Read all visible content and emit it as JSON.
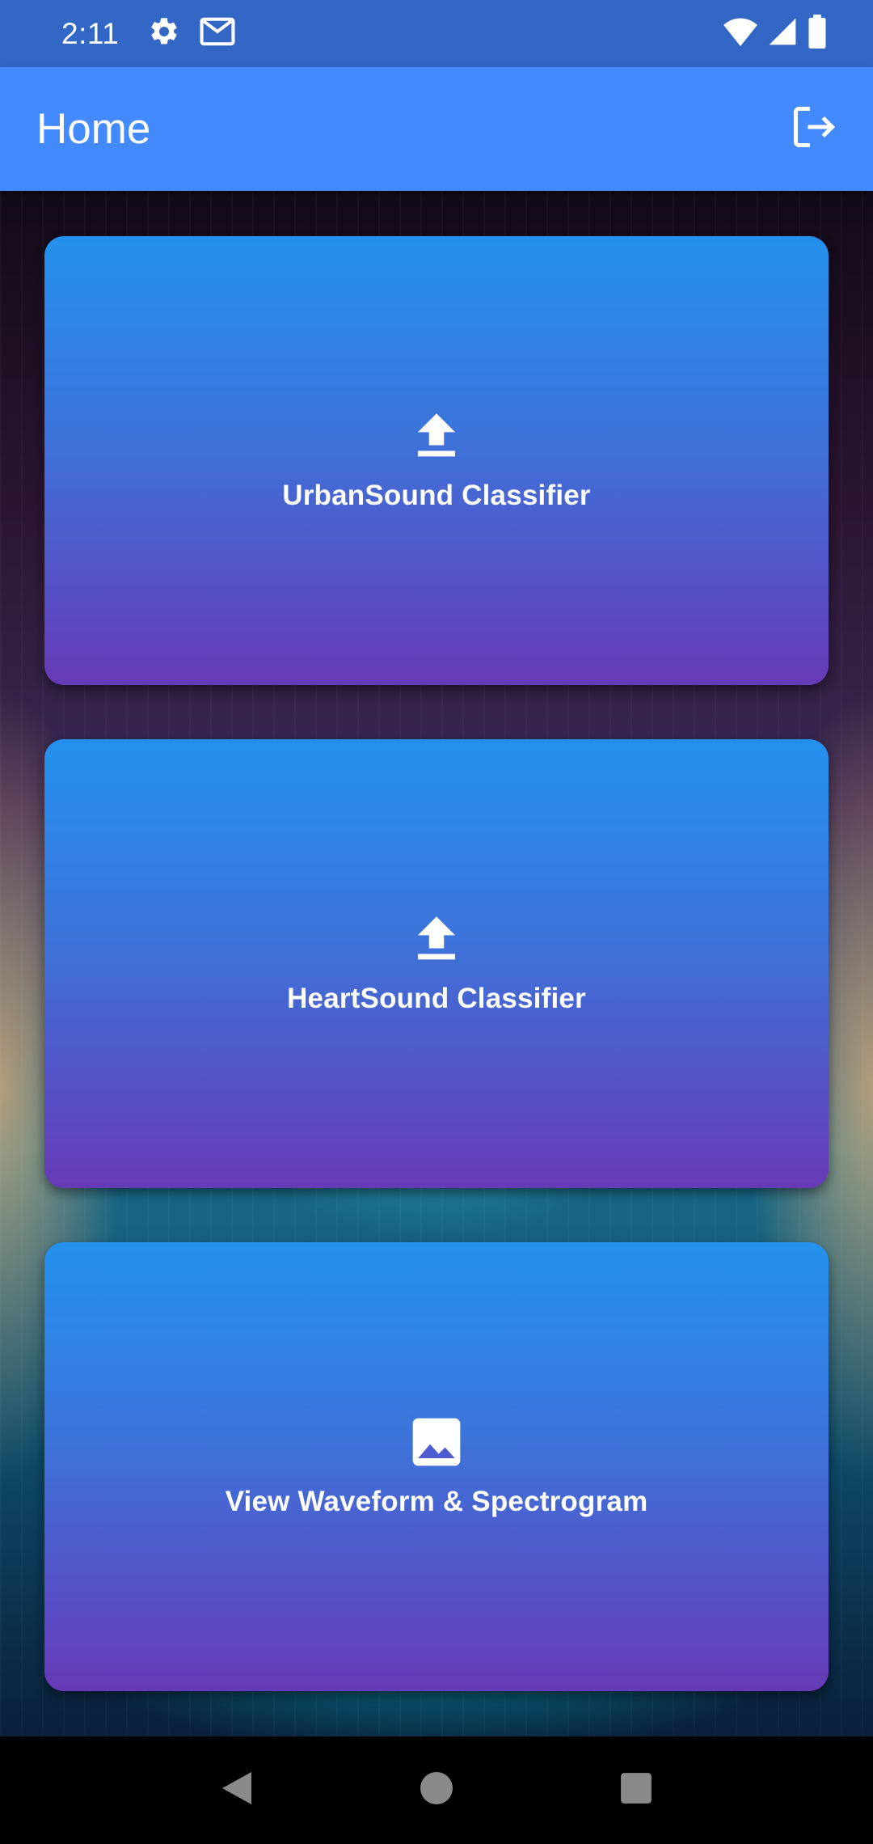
{
  "status_bar": {
    "time": "2:11",
    "left_icons": [
      "gear-icon",
      "gmail-icon"
    ],
    "right_icons": [
      "wifi-icon",
      "signal-icon",
      "battery-icon"
    ]
  },
  "app_bar": {
    "title": "Home",
    "action_icon": "logout-icon",
    "color": "#448aff"
  },
  "cards": [
    {
      "label": "UrbanSound Classifier",
      "icon": "upload-icon"
    },
    {
      "label": "HeartSound Classifier",
      "icon": "upload-icon"
    },
    {
      "label": "View Waveform & Spectrogram",
      "icon": "image-icon"
    }
  ],
  "card_gradient": {
    "top": "#2491ee",
    "bottom": "#673ab7"
  },
  "nav_bar": {
    "buttons": [
      "back-icon",
      "home-icon",
      "recents-icon"
    ]
  }
}
